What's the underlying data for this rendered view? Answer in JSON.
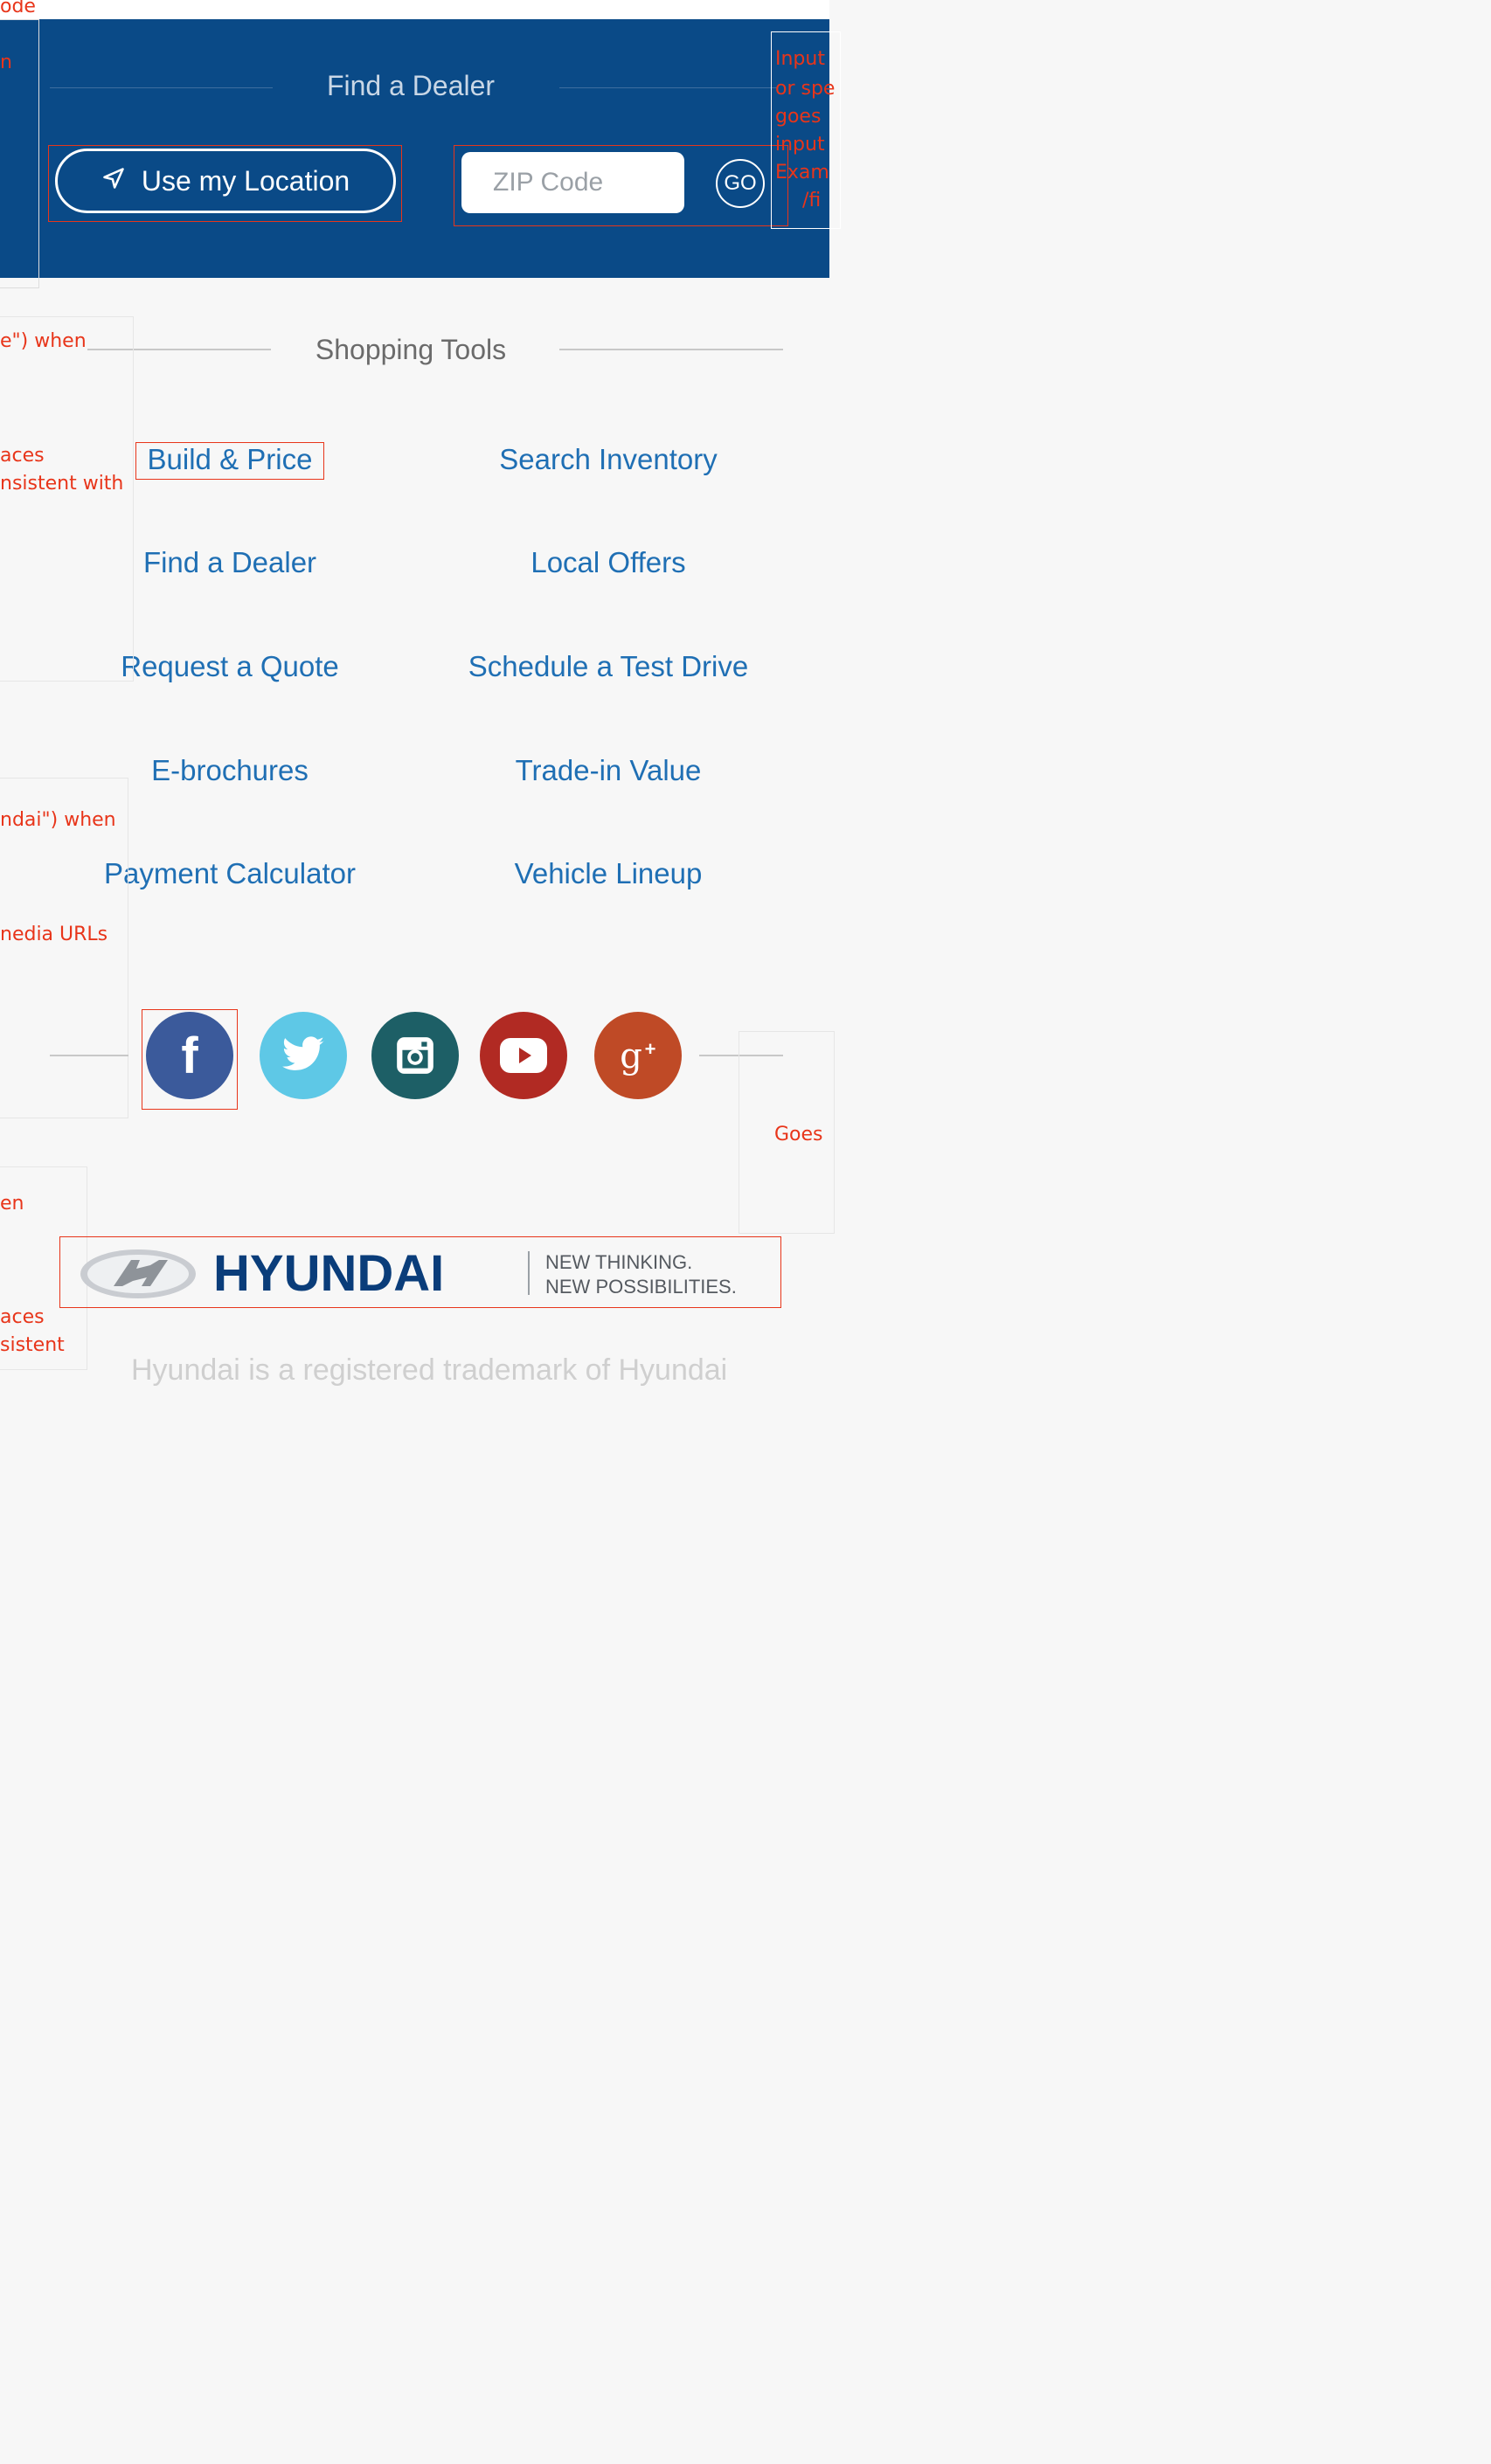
{
  "dealer": {
    "title": "Find a Dealer",
    "location_button": "Use my Location",
    "zip_placeholder": "ZIP Code",
    "go_label": "GO"
  },
  "shopping_tools": {
    "title": "Shopping Tools",
    "links": [
      "Build & Price",
      "Search Inventory",
      "Find a Dealer",
      "Local Offers",
      "Request a Quote",
      "Schedule a Test Drive",
      "E-brochures",
      "Trade-in Value",
      "Payment Calculator",
      "Vehicle Lineup"
    ]
  },
  "social": {
    "icons": [
      "facebook-icon",
      "twitter-icon",
      "instagram-icon",
      "youtube-icon",
      "google-plus-icon"
    ],
    "colors": [
      "#3b5a9b",
      "#5ec8e6",
      "#1d5f66",
      "#b12a23",
      "#bf4a26"
    ]
  },
  "brand": {
    "name": "HYUNDAI",
    "tagline_1": "NEW THINKING.",
    "tagline_2": "NEW POSSIBILITIES.",
    "trademark": "Hyundai is a registered trademark of Hyundai"
  },
  "annotations": {
    "a1": "ode",
    "a2": "n",
    "a3": "e\") when",
    "a4": "aces",
    "a5": "nsistent with",
    "a6": "ndai\") when",
    "a7": "nedia URLs",
    "a8": "Goes",
    "a9": "en",
    "a10": "aces",
    "a11": "sistent",
    "r1": "Input",
    "r2": "or spe",
    "r3": "goes",
    "r4": "input",
    "r5": "Exam",
    "r6": "/fi"
  },
  "colors": {
    "panel": "#0a4a87",
    "link": "#1f6fb4",
    "annotation": "#e8351a"
  }
}
